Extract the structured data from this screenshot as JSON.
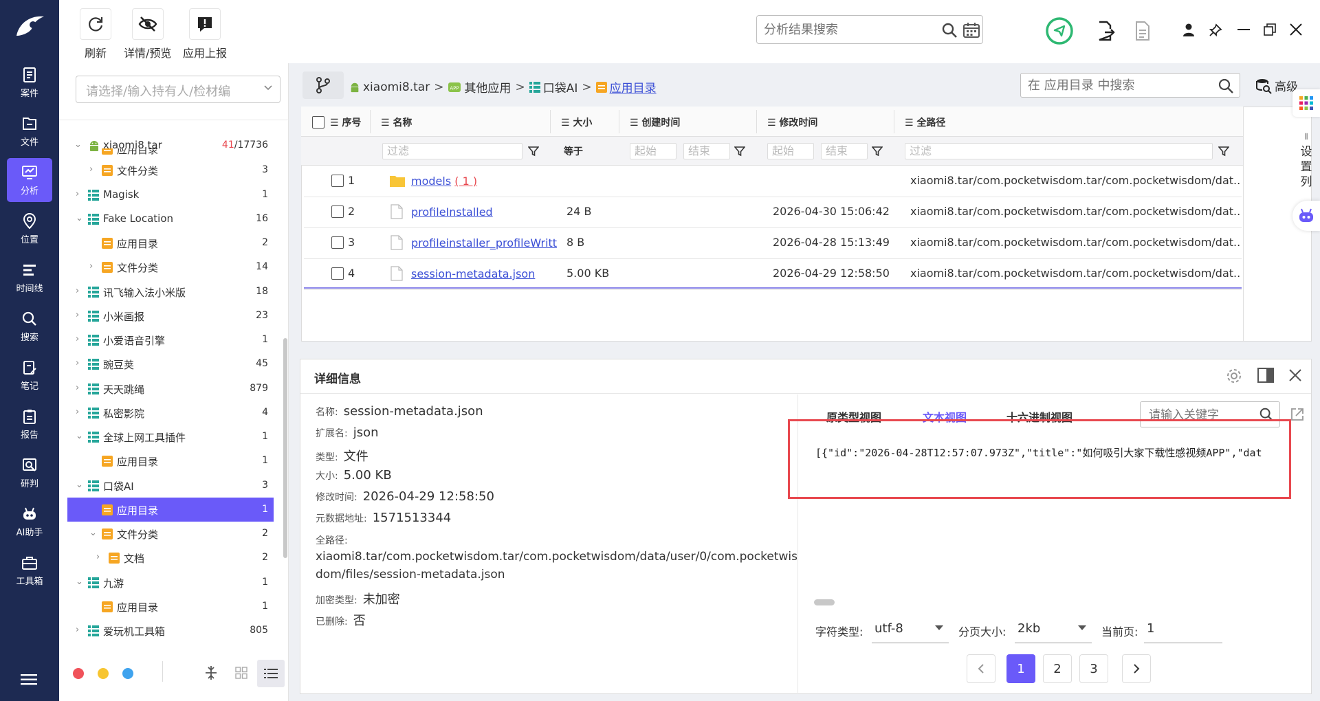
{
  "nav": {
    "items": [
      {
        "label": "案件",
        "icon": "case-icon"
      },
      {
        "label": "文件",
        "icon": "file-icon"
      },
      {
        "label": "分析",
        "icon": "analysis-icon"
      },
      {
        "label": "位置",
        "icon": "location-icon"
      },
      {
        "label": "时间线",
        "icon": "timeline-icon"
      },
      {
        "label": "搜索",
        "icon": "search-icon"
      },
      {
        "label": "笔记",
        "icon": "note-icon"
      },
      {
        "label": "报告",
        "icon": "report-icon"
      },
      {
        "label": "研判",
        "icon": "judge-icon"
      },
      {
        "label": "AI助手",
        "icon": "ai-robot-icon"
      },
      {
        "label": "工具箱",
        "icon": "toolbox-icon"
      }
    ],
    "active_index": 2
  },
  "toolbar": {
    "refresh_label": "刷新",
    "detail_preview_label": "详情/预览",
    "report_label": "应用上报",
    "search_placeholder": "分析结果搜索"
  },
  "tree": {
    "select_placeholder": "请选择/输入持有人/检材编",
    "root": {
      "label": "xiaomi8.tar",
      "count_red": "41",
      "count_total": "/17736"
    },
    "rows": [
      {
        "label": "应用目录",
        "count": "",
        "indent": 2,
        "icon": "folder-doc",
        "chev": "",
        "partial": true
      },
      {
        "label": "文件分类",
        "count": "3",
        "indent": 2,
        "icon": "folder-doc",
        "chev": ">"
      },
      {
        "label": "Magisk",
        "count": "1",
        "indent": 1,
        "icon": "app",
        "chev": ">"
      },
      {
        "label": "Fake Location",
        "count": "16",
        "indent": 1,
        "icon": "app",
        "chev": "v"
      },
      {
        "label": "应用目录",
        "count": "2",
        "indent": 2,
        "icon": "folder-doc",
        "chev": ""
      },
      {
        "label": "文件分类",
        "count": "14",
        "indent": 2,
        "icon": "folder-doc",
        "chev": ">"
      },
      {
        "label": "讯飞输入法小米版",
        "count": "18",
        "indent": 1,
        "icon": "app",
        "chev": ">"
      },
      {
        "label": "小米画报",
        "count": "23",
        "indent": 1,
        "icon": "app",
        "chev": ">"
      },
      {
        "label": "小爱语音引擎",
        "count": "1",
        "indent": 1,
        "icon": "app",
        "chev": ">"
      },
      {
        "label": "豌豆荚",
        "count": "45",
        "indent": 1,
        "icon": "app",
        "chev": ">"
      },
      {
        "label": "天天跳绳",
        "count": "879",
        "indent": 1,
        "icon": "app",
        "chev": ">"
      },
      {
        "label": "私密影院",
        "count": "4",
        "indent": 1,
        "icon": "app",
        "chev": ">"
      },
      {
        "label": "全球上网工具插件",
        "count": "1",
        "indent": 1,
        "icon": "app",
        "chev": "v"
      },
      {
        "label": "应用目录",
        "count": "1",
        "indent": 2,
        "icon": "folder-doc",
        "chev": ""
      },
      {
        "label": "口袋AI",
        "count": "3",
        "indent": 1,
        "icon": "app",
        "chev": "v"
      },
      {
        "label": "应用目录",
        "count": "1",
        "indent": 2,
        "icon": "folder-doc",
        "chev": "",
        "selected": true
      },
      {
        "label": "文件分类",
        "count": "2",
        "indent": 2,
        "icon": "folder-doc",
        "chev": "v"
      },
      {
        "label": "文档",
        "count": "2",
        "indent": 3,
        "icon": "folder-doc",
        "chev": ">"
      },
      {
        "label": "九游",
        "count": "1",
        "indent": 1,
        "icon": "app",
        "chev": "v"
      },
      {
        "label": "应用目录",
        "count": "1",
        "indent": 2,
        "icon": "folder-doc",
        "chev": ""
      },
      {
        "label": "爱玩机工具箱",
        "count": "805",
        "indent": 1,
        "icon": "app",
        "chev": ">"
      }
    ]
  },
  "breadcrumb": {
    "items": [
      "xiaomi8.tar",
      "其他应用",
      "口袋AI",
      "应用目录"
    ],
    "separator": ">",
    "search_placeholder": "在 应用目录 中搜索",
    "advanced_label": "高级"
  },
  "table": {
    "headers": {
      "index": "序号",
      "name": "名称",
      "size": "大小",
      "created": "创建时间",
      "modified": "修改时间",
      "path": "全路径"
    },
    "filters": {
      "name": "过滤",
      "size": "等于",
      "start": "起始",
      "end": "结束",
      "path": "过滤"
    },
    "rows": [
      {
        "index": "1",
        "name": "models",
        "name_suffix": "( 1 )",
        "type": "folder",
        "size": "",
        "modified": "",
        "path": "xiaomi8.tar/com.pocketwisdom.tar/com.pocketwisdom/dat..."
      },
      {
        "index": "2",
        "name": "profileInstalled",
        "type": "file",
        "size": "24 B",
        "modified": "2026-04-30 15:06:42",
        "path": "xiaomi8.tar/com.pocketwisdom.tar/com.pocketwisdom/dat..."
      },
      {
        "index": "3",
        "name": "profileinstaller_profileWritte",
        "type": "file",
        "size": "8 B",
        "modified": "2026-04-28 15:13:49",
        "path": "xiaomi8.tar/com.pocketwisdom.tar/com.pocketwisdom/dat..."
      },
      {
        "index": "4",
        "name": "session-metadata.json",
        "type": "file",
        "size": "5.00 KB",
        "modified": "2026-04-29 12:58:50",
        "path": "xiaomi8.tar/com.pocketwisdom.tar/com.pocketwisdom/dat..."
      }
    ]
  },
  "side_strip": {
    "setting_label": "设置列"
  },
  "detail": {
    "title": "详细信息",
    "name_key": "名称:",
    "name_val": "session-metadata.json",
    "ext_key": "扩展名:",
    "ext_val": "json",
    "type_key": "类型:",
    "type_val": "文件",
    "size_key": "大小:",
    "size_val": "5.00 KB",
    "mtime_key": "修改时间:",
    "mtime_val": "2026-04-29 12:58:50",
    "meta_key": "元数据地址:",
    "meta_val": "1571513344",
    "path_key": "全路径:",
    "path_line1": "xiaomi8.tar/com.pocketwisdom.tar/com.pocketwisdom/data/user/0/com.pocketwis",
    "path_line2": "dom/files/session-metadata.json",
    "enc_key": "加密类型:",
    "enc_val": "未加密",
    "del_key": "已删除:",
    "del_val": "否"
  },
  "viewer": {
    "tabs": [
      "原类型视图",
      "文本视图",
      "十六进制视图"
    ],
    "active_tab": 1,
    "search_placeholder": "请输入关键字",
    "content": "[{\"id\":\"2026-04-28T12:57:07.973Z\",\"title\":\"如何吸引大家下载性感视频APP\",\"dat",
    "charset_label": "字符类型:",
    "charset_value": "utf-8",
    "pagesize_label": "分页大小:",
    "pagesize_value": "2kb",
    "curpage_label": "当前页:",
    "curpage_value": "1",
    "pages": [
      "1",
      "2",
      "3"
    ],
    "active_page": 0
  },
  "colors": {
    "accent": "#6a5af9",
    "nav_bg": "#1d2a52",
    "highlight_box": "#e8484f",
    "link": "#3b4fd6",
    "count_red": "#e8484f"
  }
}
